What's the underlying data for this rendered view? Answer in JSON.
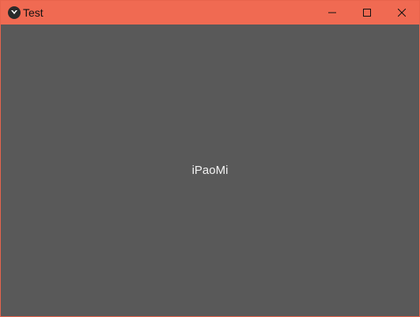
{
  "window": {
    "title": "Test",
    "app_icon": "kivy-logo-icon",
    "controls": {
      "minimize_icon": "minimize-icon",
      "maximize_icon": "maximize-icon",
      "close_icon": "close-icon"
    }
  },
  "content": {
    "label": "iPaoMi"
  },
  "colors": {
    "titlebar": "#f06a52",
    "background": "#595959",
    "label_text": "#f2f2f2"
  }
}
